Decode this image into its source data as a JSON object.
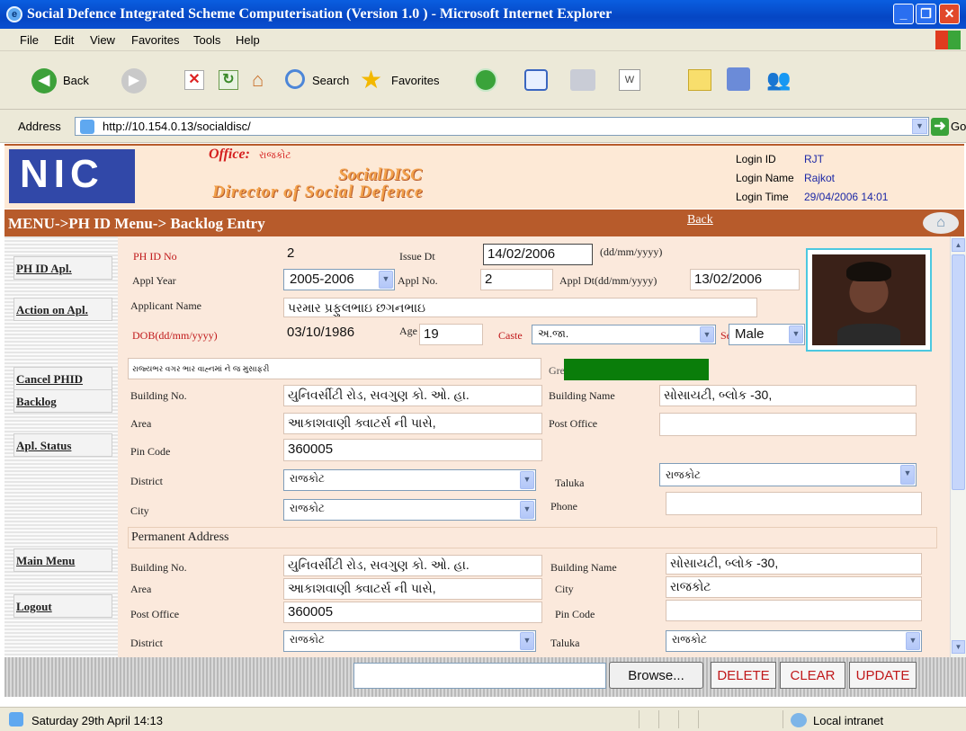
{
  "window": {
    "title": "Social Defence Integrated Scheme Computerisation (Version 1.0 ) - Microsoft Internet Explorer"
  },
  "menu": [
    "File",
    "Edit",
    "View",
    "Favorites",
    "Tools",
    "Help"
  ],
  "toolbar": {
    "back": "Back",
    "search": "Search",
    "favorites": "Favorites"
  },
  "address": {
    "label": "Address",
    "url": "http://10.154.0.13/socialdisc/",
    "go": "Go"
  },
  "header": {
    "logo_text": "NIC",
    "office_label": "Office:",
    "office_value": "રાજકોટ",
    "app_short": "SocialDISC",
    "app_full": "Director of Social Defence",
    "login": [
      {
        "label": "Login ID",
        "value": "RJT"
      },
      {
        "label": "Login Name",
        "value": "Rajkot"
      },
      {
        "label": "Login Time",
        "value": "29/04/2006 14:01"
      }
    ]
  },
  "breadcrumb": "MENU->PH ID Menu-> Backlog Entry",
  "back_link": "Back",
  "sidebar": [
    "PH ID Apl.",
    "Action on Apl.",
    "Cancel PHID",
    "Backlog",
    "Apl. Status",
    "Main Menu",
    "Logout"
  ],
  "form": {
    "ph_id_label": "PH ID No",
    "ph_id": "2",
    "issue_dt_label": "Issue Dt",
    "issue_dt": "14/02/2006",
    "date_fmt": "(dd/mm/yyyy)",
    "appl_year_label": "Appl Year",
    "appl_year": "2005-2006",
    "appl_no_label": "Appl No.",
    "appl_no": "2",
    "appl_dt_label": "Appl Dt(dd/mm/yyyy)",
    "appl_dt": "13/02/2006",
    "applicant_label": "Applicant Name",
    "applicant": "પરમાર પ્રફુલભાઇ છગનભાઇ",
    "dob_label": "DOB(dd/mm/yyyy)",
    "dob": "03/10/1986",
    "age_label": "Age",
    "age": "19",
    "caste_label": "Caste",
    "caste": "અ.જા.",
    "sex_label": "Sex",
    "sex": "Male",
    "note": "રાજ્યભર વગર ભાર વાહ્નમાં ને જ મુસાફરી",
    "card_label": "Green",
    "building_no_label": "Building No.",
    "building_no": "યુનિવર્સીટી રોડ, સવગુણ કો. ઓ. હા.",
    "building_name_label": "Building Name",
    "building_name": "સોસાયટી, બ્લોક -30,",
    "area_label": "Area",
    "area": "આકાશવાણી ક્વાટર્સ ની પાસે,",
    "post_office_label": "Post Office",
    "post_office": "",
    "pin_label": "Pin Code",
    "pin": "360005",
    "district_label": "District",
    "district": "રાજકોટ",
    "taluka_label": "Taluka",
    "taluka": "રાજકોટ",
    "city_label": "City",
    "city": "રાજકોટ",
    "phone_label": "Phone",
    "phone": "",
    "perm_label": "Permanent Address",
    "p_building_no": "યુનિવર્સીટી રોડ, સવગુણ કો. ઓ. હા.",
    "p_building_name": "સોસાયટી, બ્લોક -30,",
    "p_area": "આકાશવાણી ક્વાટર્સ ની પાસે,",
    "p_city_label": "City",
    "p_city": "રાજકોટ",
    "p_post_office": "360005",
    "p_pin_label": "Pin Code",
    "p_pin": "",
    "p_district": "રાજકોટ",
    "p_taluka": "રાજકોટ"
  },
  "actions": {
    "browse": "Browse...",
    "delete": "DELETE",
    "clear": "CLEAR",
    "update": "UPDATE"
  },
  "status": {
    "text": "Saturday 29th April 14:13",
    "zone": "Local intranet"
  },
  "colors": {
    "brand": "#b75b2b",
    "form_bg": "#fbe9dc",
    "header_bg": "#fde9d6",
    "card_green": "#0a7d0a"
  }
}
